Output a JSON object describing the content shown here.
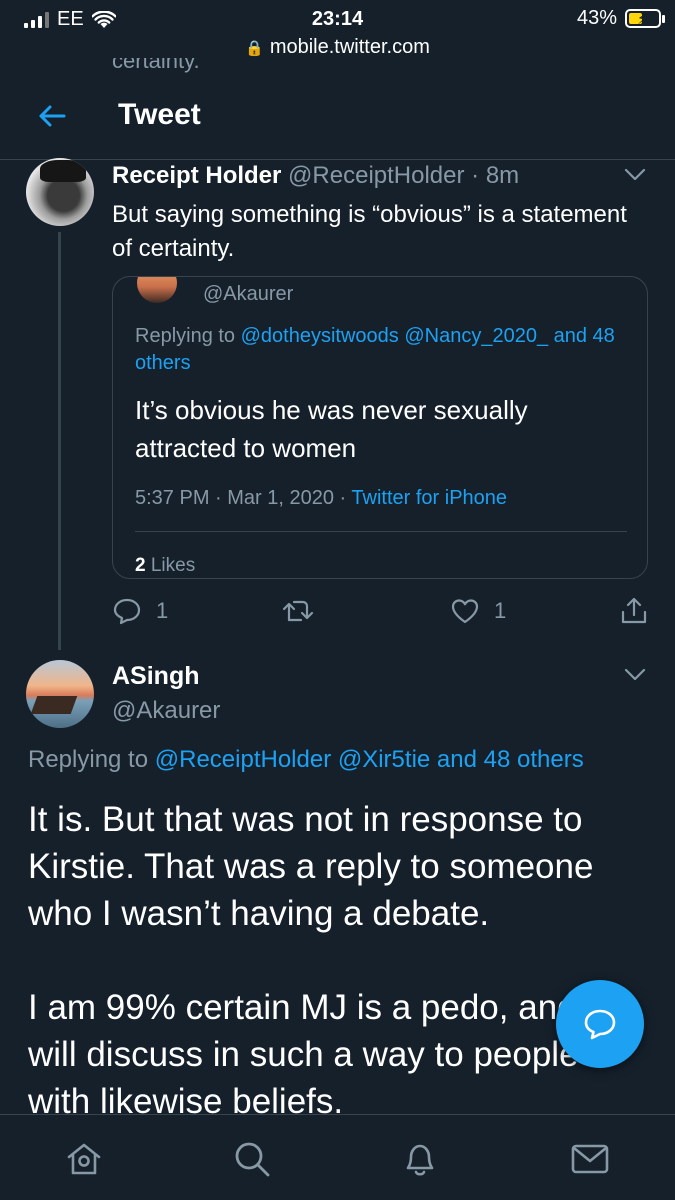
{
  "status_bar": {
    "carrier": "EE",
    "time": "23:14",
    "battery": "43%",
    "url": "mobile.twitter.com"
  },
  "peek_text": "certainty.",
  "header": {
    "title": "Tweet"
  },
  "tweet1": {
    "name": "Receipt Holder",
    "handle": "@ReceiptHolder",
    "time": "· 8m",
    "text": "But saying something is “obvious” is a statement of certainty.",
    "quote": {
      "handle": "@Akaurer",
      "replying_prefix": "Replying to",
      "replying_links": "@dotheysitwoods @Nancy_2020_ and 48 others",
      "text": "It’s obvious he was never sexually attracted to women",
      "timestamp": "5:37 PM · Mar 1, 2020 ·",
      "source": "Twitter for iPhone",
      "likes_count": "2",
      "likes_label": "Likes"
    },
    "reply_count": "1",
    "like_count": "1"
  },
  "tweet2": {
    "name": "ASingh",
    "handle": "@Akaurer",
    "replying_prefix": "Replying to",
    "replying_links": "@ReceiptHolder @Xir5tie and 48 others",
    "paragraph1_line1": "It is. But that was not in response to",
    "paragraph1_line2": "Kirstie. That was a reply to someone",
    "paragraph1_line3": "who I wasn’t having a debate.",
    "paragraph2_line1": "I am 99% certain MJ is a pedo, and",
    "paragraph2_line2": "will discuss in such a way to people",
    "paragraph2_line3": "with likewise beliefs."
  },
  "icons": {
    "back": "arrow-left-icon",
    "compose": "compose-reply-icon",
    "nav": [
      "home-icon",
      "search-icon",
      "notifications-icon",
      "messages-icon"
    ]
  },
  "colors": {
    "background": "#15202b",
    "accent": "#1da1f2",
    "secondary_text": "#8899a6",
    "border": "#38444d"
  }
}
